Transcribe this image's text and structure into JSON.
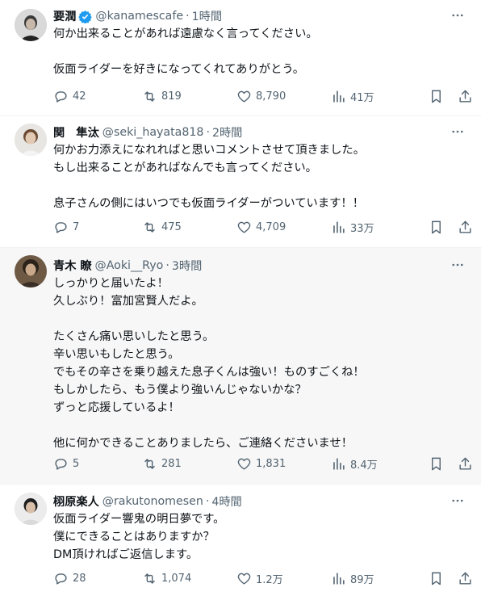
{
  "replies": [
    {
      "name": "要潤",
      "verified": true,
      "handle": "@kanamescafe",
      "time": "1時間",
      "lines": [
        "何か出来ることがあれば遠慮なく言ってください。",
        "",
        "仮面ライダーを好きになってくれてありがとう。"
      ],
      "replies": "42",
      "reposts": "819",
      "likes": "8,790",
      "views": "41万"
    },
    {
      "name": "関　隼汰",
      "verified": false,
      "handle": "@seki_hayata818",
      "time": "2時間",
      "lines": [
        "何かお力添えになれればと思いコメントさせて頂きました。",
        "もし出来ることがあればなんでも言ってください。",
        "",
        "息子さんの側にはいつでも仮面ライダーがついています！！"
      ],
      "replies": "7",
      "reposts": "475",
      "likes": "4,709",
      "views": "33万"
    },
    {
      "name": "青木 瞭",
      "verified": false,
      "handle": "@Aoki__Ryo",
      "time": "3時間",
      "lines": [
        "しっかりと届いたよ！",
        "久しぶり！富加宮賢人だよ。",
        "",
        "たくさん痛い思いしたと思う。",
        "辛い思いもしたと思う。",
        "でもその辛さを乗り越えた息子くんは強い！ものすごくね！",
        "もしかしたら、もう僕より強いんじゃないかな？",
        "ずっと応援しているよ！",
        "",
        "他に何かできることありましたら、ご連絡くださいませ！"
      ],
      "replies": "5",
      "reposts": "281",
      "likes": "1,831",
      "views": "8.4万"
    },
    {
      "name": "栩原楽人",
      "verified": false,
      "handle": "@rakutonomesen",
      "time": "4時間",
      "lines": [
        "仮面ライダー響鬼の明日夢です。",
        "僕にできることはありますか？",
        "DM頂ければご返信します。"
      ],
      "replies": "28",
      "reposts": "1,074",
      "likes": "1.2万",
      "views": "89万"
    }
  ],
  "colors": {
    "text": "#0f1419",
    "secondary": "#536471",
    "verified": "#1d9bf0",
    "highlight_bg": "#f7f7f7",
    "divider": "#eff3f4"
  },
  "icons": [
    "more-icon",
    "reply-icon",
    "repost-icon",
    "like-icon",
    "views-icon",
    "bookmark-icon",
    "share-icon",
    "verified-badge-icon"
  ]
}
